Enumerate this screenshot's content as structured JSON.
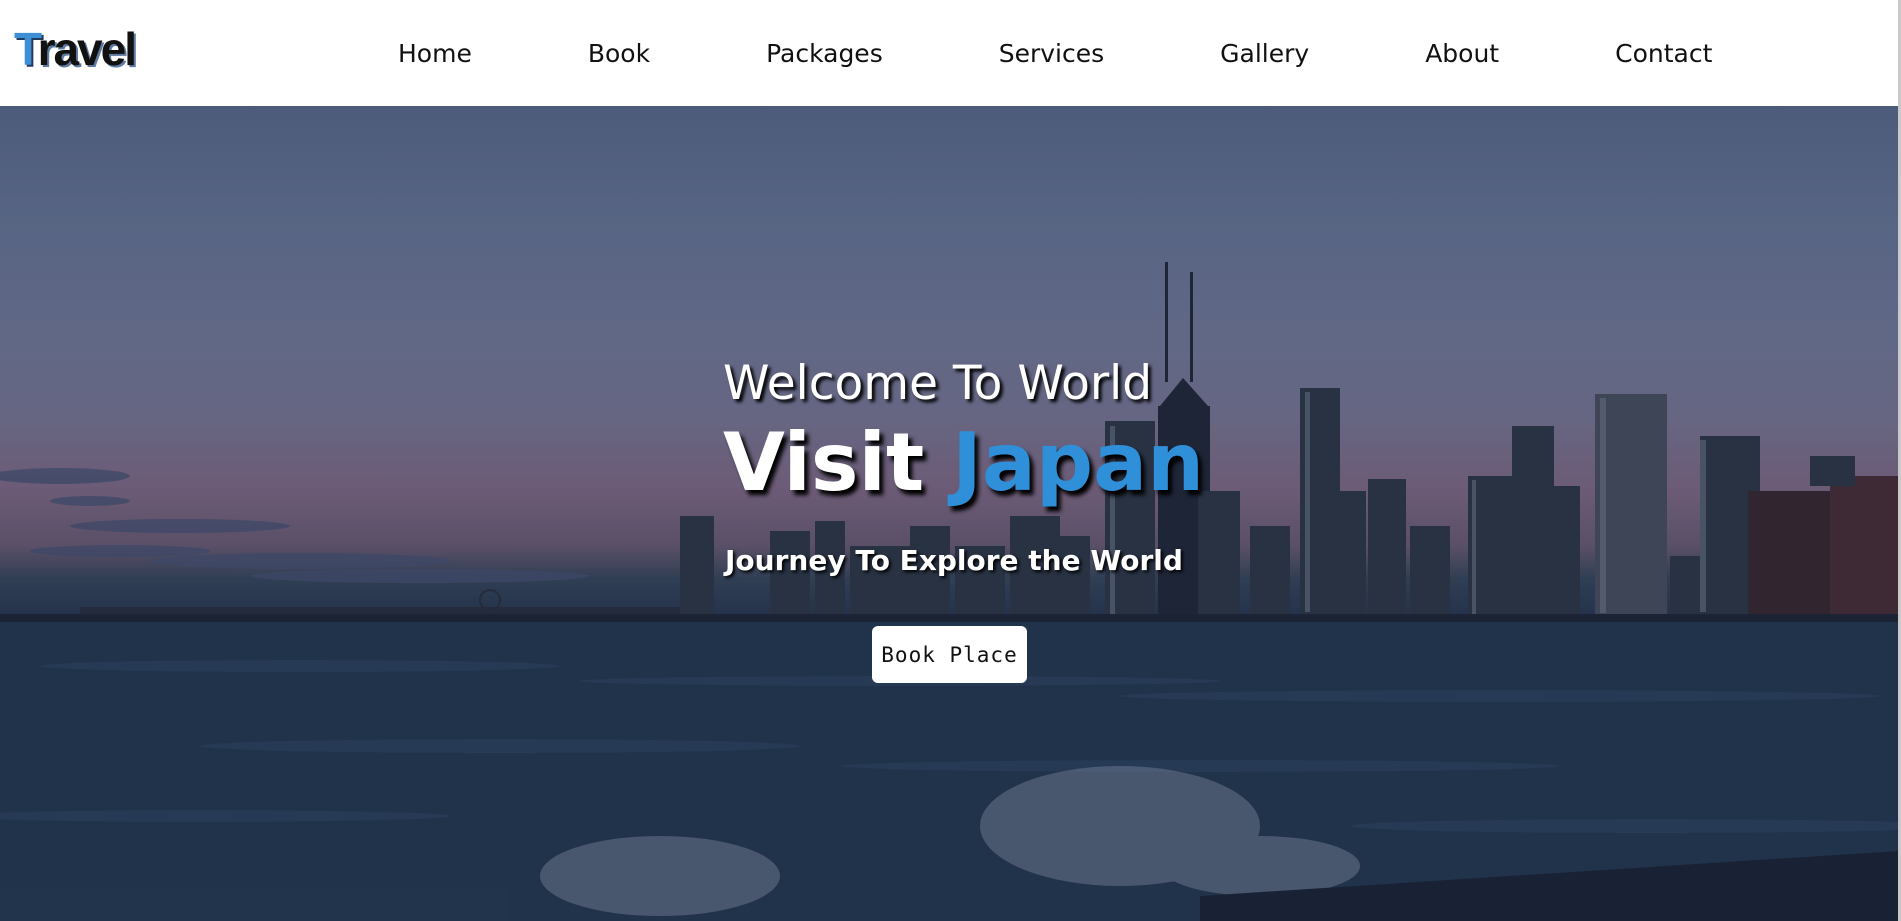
{
  "header": {
    "logo_first": "T",
    "logo_rest": "ravel",
    "nav": [
      {
        "label": "Home"
      },
      {
        "label": "Book"
      },
      {
        "label": "Packages"
      },
      {
        "label": "Services"
      },
      {
        "label": "Gallery"
      },
      {
        "label": "About"
      },
      {
        "label": "Contact"
      }
    ]
  },
  "hero": {
    "welcome": "Welcome To World",
    "visit": "Visit",
    "destination": "Japan",
    "tagline": "Journey To Explore the World",
    "button_label": "Book Place"
  },
  "colors": {
    "accent": "#2f8fd9",
    "header_bg": "#ffffff",
    "button_bg": "#ffffff"
  }
}
